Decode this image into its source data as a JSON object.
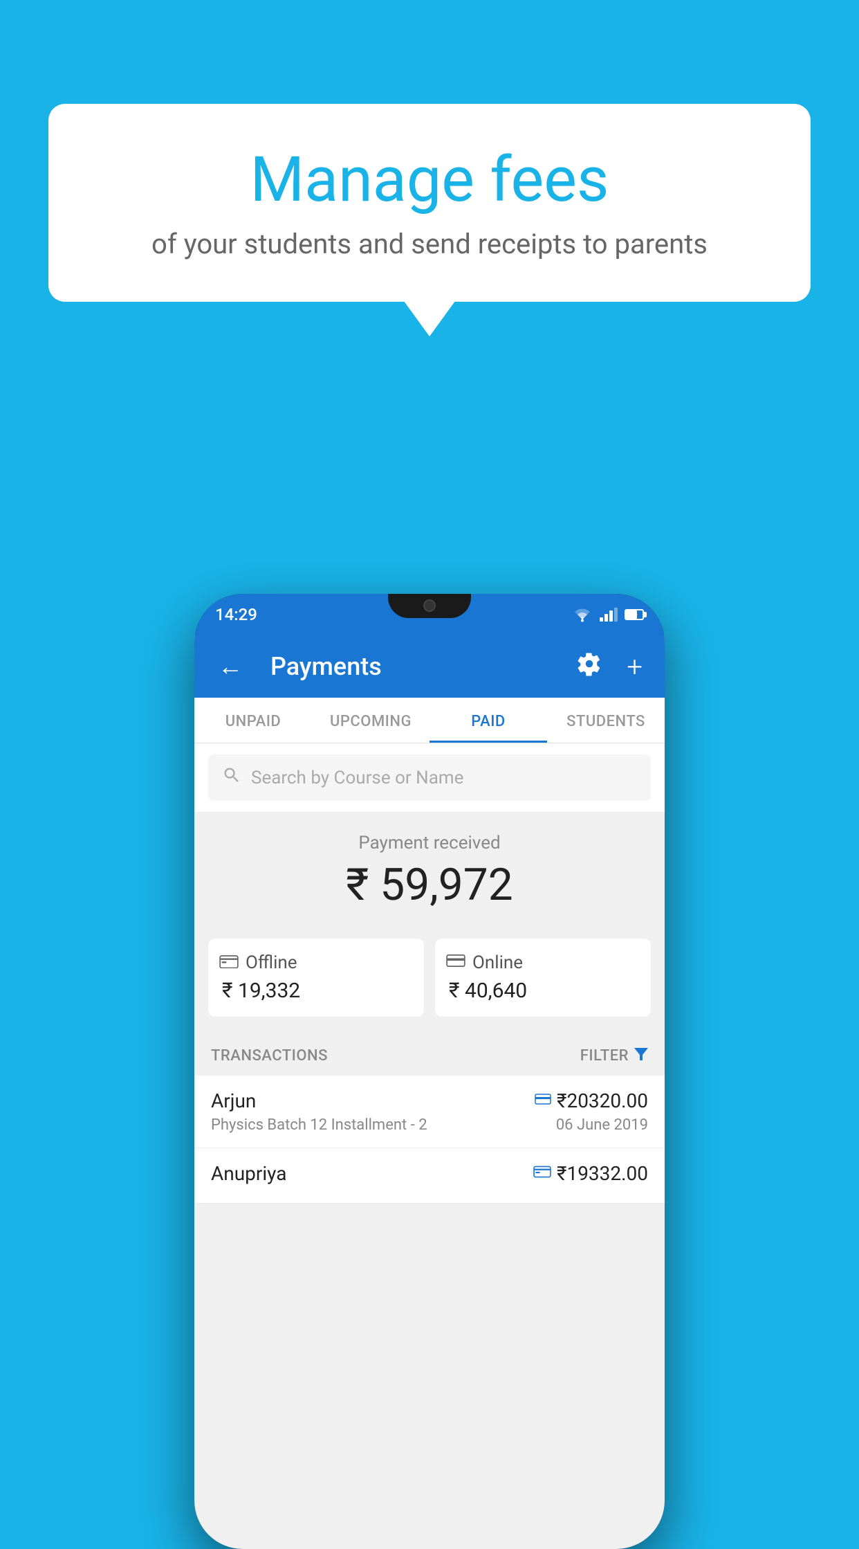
{
  "background_color": "#1ab3e8",
  "bubble": {
    "title": "Manage fees",
    "subtitle": "of your students and send receipts to parents"
  },
  "phone": {
    "status_bar": {
      "time": "14:29"
    },
    "toolbar": {
      "title": "Payments",
      "back_label": "←",
      "plus_label": "+"
    },
    "tabs": [
      {
        "label": "UNPAID",
        "active": false
      },
      {
        "label": "UPCOMING",
        "active": false
      },
      {
        "label": "PAID",
        "active": true
      },
      {
        "label": "STUDENTS",
        "active": false
      }
    ],
    "search": {
      "placeholder": "Search by Course or Name"
    },
    "payment_summary": {
      "received_label": "Payment received",
      "amount": "₹ 59,972",
      "offline": {
        "label": "Offline",
        "amount": "₹ 19,332"
      },
      "online": {
        "label": "Online",
        "amount": "₹ 40,640"
      }
    },
    "transactions": {
      "label": "TRANSACTIONS",
      "filter_label": "FILTER",
      "items": [
        {
          "name": "Arjun",
          "course": "Physics Batch 12 Installment - 2",
          "amount": "₹20320.00",
          "date": "06 June 2019",
          "payment_type": "online"
        },
        {
          "name": "Anupriya",
          "course": "",
          "amount": "₹19332.00",
          "date": "",
          "payment_type": "offline"
        }
      ]
    }
  }
}
